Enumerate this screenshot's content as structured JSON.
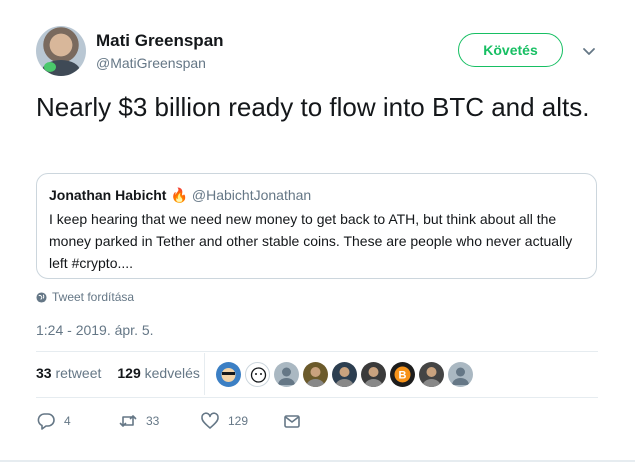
{
  "author": {
    "name": "Mati Greenspan",
    "handle": "@MatiGreenspan",
    "follow_label": "Követés"
  },
  "tweet": {
    "text": "Nearly $3 billion ready to flow into BTC and alts.",
    "timestamp": "1:24 - 2019. ápr. 5.",
    "translate_label": "Tweet fordítása"
  },
  "quote": {
    "name": "Jonathan Habicht",
    "emoji": "🔥",
    "handle": "@HabichtJonathan",
    "text": "I keep hearing that we need new money to get back to ATH, but think about all the money parked in Tether and other stable coins. These are people who never actually left #crypto...."
  },
  "stats": {
    "retweets_count": "33",
    "retweets_label": "retweet",
    "likes_count": "129",
    "likes_label": "kedvelés"
  },
  "likers": [
    {
      "icon": "avatar-cartoon",
      "color": "#3b7fc4"
    },
    {
      "icon": "avatar-sheep",
      "color": "#ffffff"
    },
    {
      "icon": "avatar-default",
      "color": "#aab8c2"
    },
    {
      "icon": "avatar-photo",
      "color": "#6b5a2b"
    },
    {
      "icon": "avatar-photo",
      "color": "#2c3e50"
    },
    {
      "icon": "avatar-photo",
      "color": "#3a3a3a"
    },
    {
      "icon": "avatar-bitcoin",
      "color": "#1d1d1d"
    },
    {
      "icon": "avatar-photo",
      "color": "#444444"
    },
    {
      "icon": "avatar-default",
      "color": "#aab8c2"
    }
  ],
  "actions": {
    "reply_count": "4",
    "retweet_count": "33",
    "like_count": "129"
  },
  "colors": {
    "accent": "#17bf63",
    "text": "#14171a",
    "muted": "#657786",
    "border": "#ccd6dd"
  }
}
